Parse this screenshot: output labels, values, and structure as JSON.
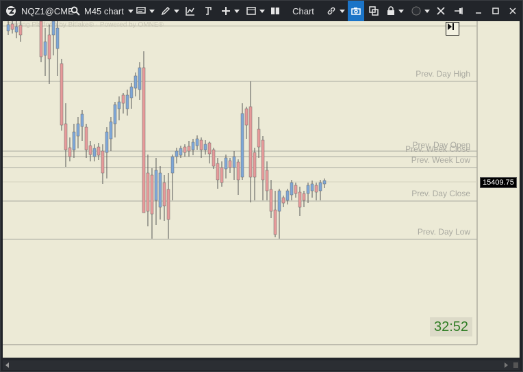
{
  "titlebar": {
    "symbol": "NQZ1@CME",
    "timeframe": "M45 chart",
    "chart_type_label": "Chart"
  },
  "chart": {
    "watermark": "Trading Platform by Bitlake® · Powered by OMNE®",
    "current_price": "15409.75",
    "countdown": "32:52",
    "level_lines": [
      {
        "label": "Prev. Day High",
        "value": 0.0
      },
      {
        "label": "Prev. Day Open",
        "value": 0.0
      },
      {
        "label": "Prev. Week Close",
        "value": 0.0
      },
      {
        "label": "Prev. Week Low",
        "value": 0.0
      },
      {
        "label": "Prev. Day Close",
        "value": 0.0
      },
      {
        "label": "Prev. Day Low",
        "value": 0.0
      }
    ]
  },
  "colors": {
    "background": "#ecead6",
    "bull": "#7ea7d8",
    "bear": "#e79a9a",
    "wick": "#555555",
    "level_line": "#a9a9a0",
    "accent": "#1b74c7",
    "timer_text": "#2f7d24"
  }
}
